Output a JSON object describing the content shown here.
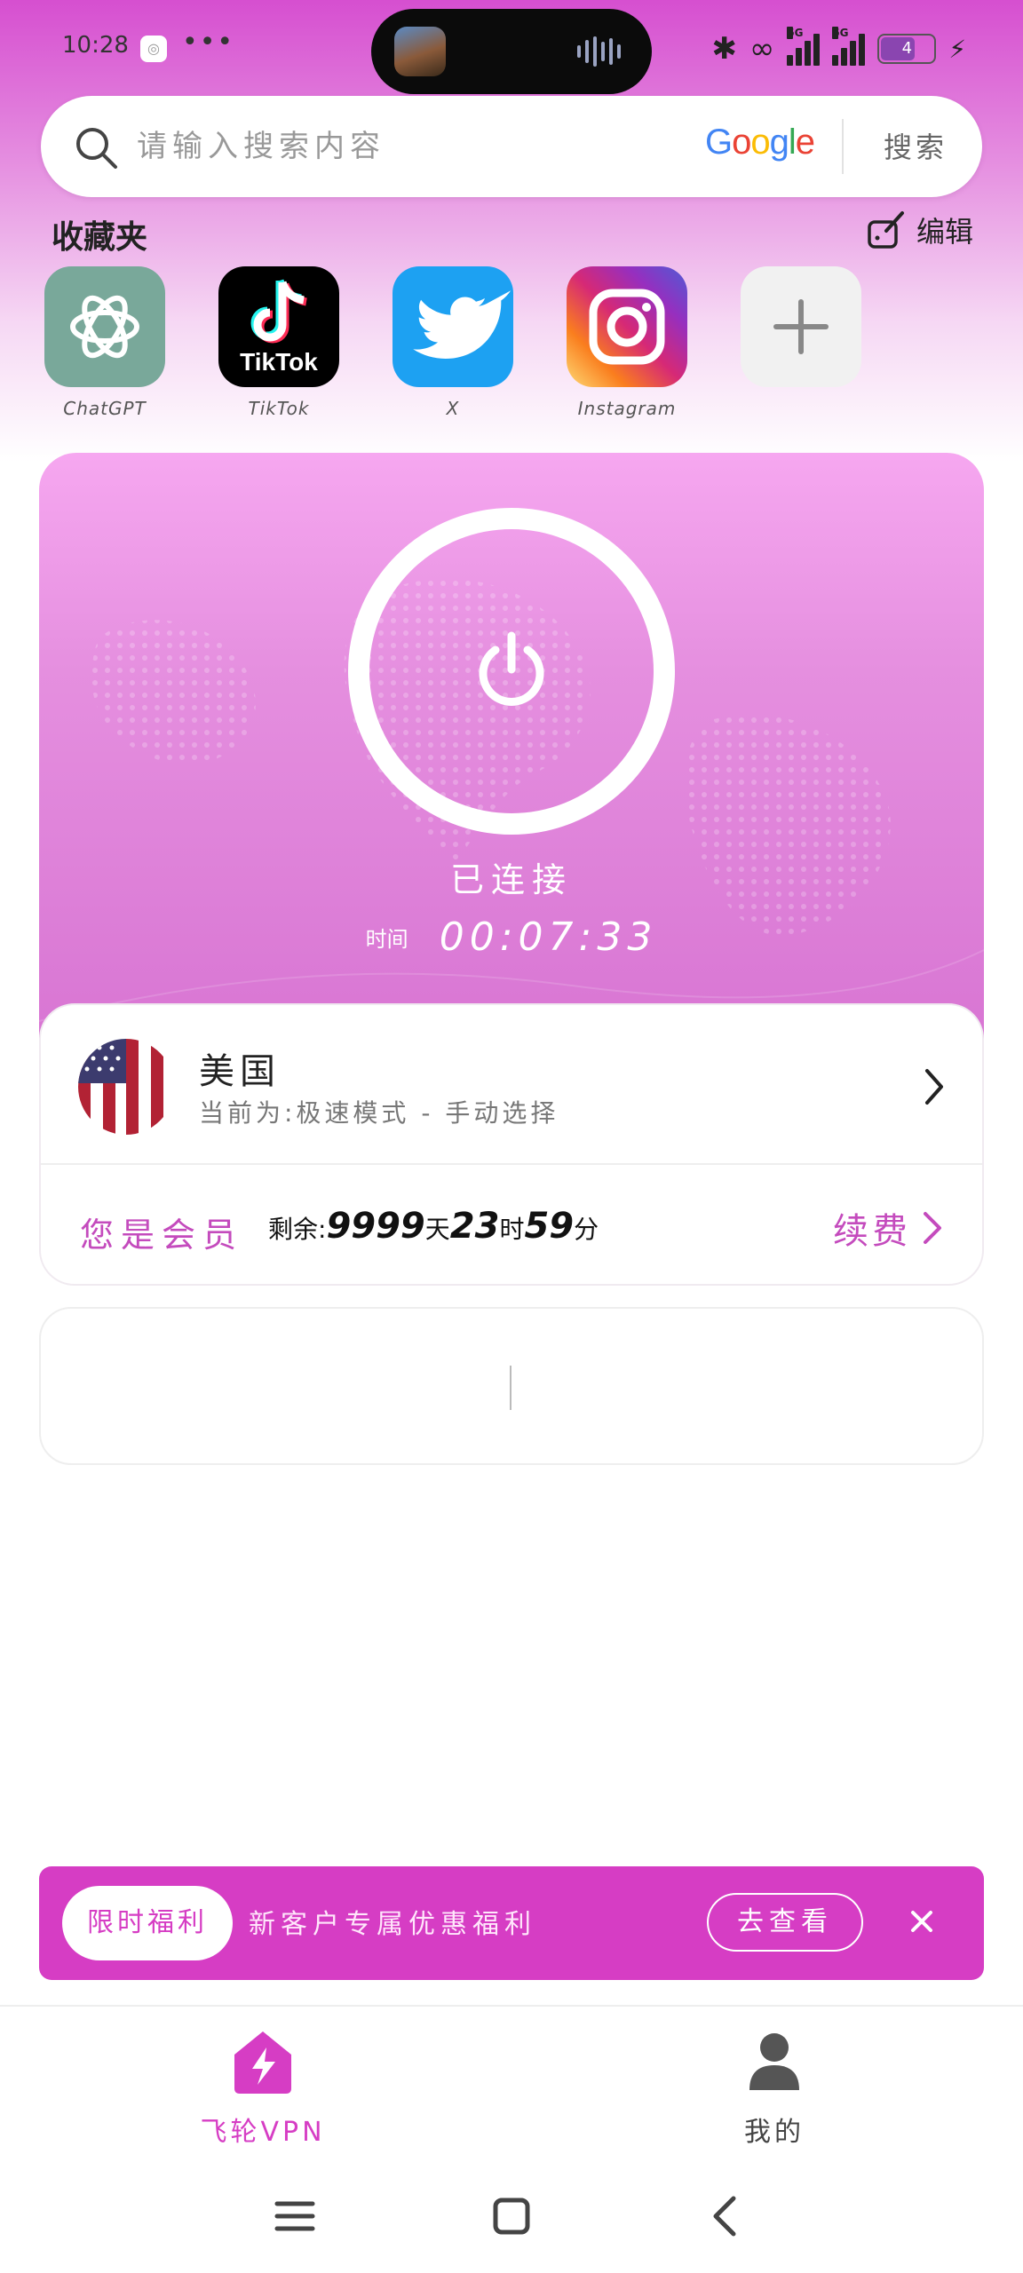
{
  "status_bar": {
    "time": "10:28",
    "dots": "•••",
    "battery": "4",
    "network": "5G"
  },
  "search": {
    "placeholder": "请输入搜索内容",
    "google": "Google",
    "button": "搜索"
  },
  "favorites": {
    "title": "收藏夹",
    "edit_label": "编辑",
    "items": [
      {
        "label": "ChatGPT",
        "icon": "chatgpt-icon"
      },
      {
        "label": "TikTok",
        "icon": "tiktok-icon",
        "brand": "TikTok"
      },
      {
        "label": "X",
        "icon": "twitter-bird-icon"
      },
      {
        "label": "Instagram",
        "icon": "instagram-icon"
      },
      {
        "label": "",
        "icon": "plus-icon"
      }
    ]
  },
  "vpn": {
    "status": "已连接",
    "time_label": "时间",
    "time_value": "00:07:33"
  },
  "server": {
    "country": "美国",
    "mode": "当前为:极速模式 - 手动选择",
    "member_label": "您是会员",
    "remain_prefix": "剩余:",
    "days": "9999",
    "days_unit": "天",
    "hours": "23",
    "hours_unit": "时",
    "minutes": "59",
    "minutes_unit": "分",
    "renew": "续费"
  },
  "promo": {
    "badge": "限时福利",
    "text": "新客户专属优惠福利",
    "button": "去查看"
  },
  "bottom_nav": {
    "home": "飞轮VPN",
    "mine": "我的"
  },
  "colors": {
    "accent": "#d63dc4",
    "card_top": "#f6a7f0",
    "card_bottom": "#d773d2"
  }
}
